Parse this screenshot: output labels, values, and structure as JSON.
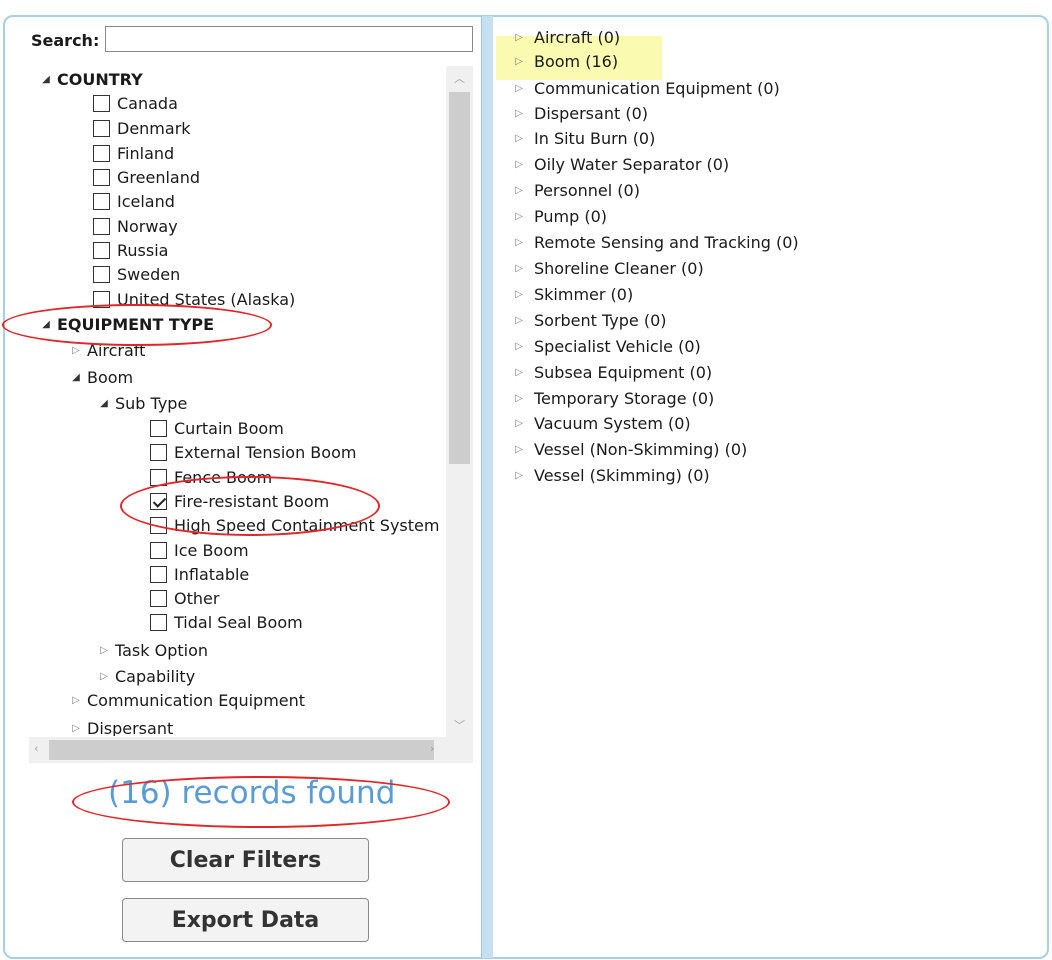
{
  "search": {
    "label": "Search:",
    "value": "",
    "placeholder": ""
  },
  "tree": {
    "country": {
      "label": "COUNTRY",
      "items": [
        "Canada",
        "Denmark",
        "Finland",
        "Greenland",
        "Iceland",
        "Norway",
        "Russia",
        "Sweden",
        "United States (Alaska)"
      ]
    },
    "equipment_type": {
      "label": "EQUIPMENT TYPE",
      "aircraft": "Aircraft",
      "boom": {
        "label": "Boom",
        "sub_type": {
          "label": "Sub Type",
          "items": [
            {
              "label": "Curtain Boom",
              "checked": false
            },
            {
              "label": "External Tension Boom",
              "checked": false
            },
            {
              "label": "Fence Boom",
              "checked": false
            },
            {
              "label": "Fire-resistant Boom",
              "checked": true
            },
            {
              "label": "High Speed Containment System",
              "checked": false
            },
            {
              "label": "Ice Boom",
              "checked": false
            },
            {
              "label": "Inflatable",
              "checked": false
            },
            {
              "label": "Other",
              "checked": false
            },
            {
              "label": "Tidal Seal Boom",
              "checked": false
            }
          ]
        },
        "task_option": "Task Option",
        "capability": "Capability"
      },
      "communication_equipment": "Communication Equipment",
      "dispersant": "Dispersant"
    }
  },
  "status": {
    "records_found": "(16) records found"
  },
  "buttons": {
    "clear_filters": "Clear Filters",
    "export_data": "Export Data"
  },
  "results": [
    "Aircraft (0)",
    "Boom (16)",
    "Communication Equipment (0)",
    "Dispersant (0)",
    "In Situ Burn (0)",
    "Oily Water Separator (0)",
    "Personnel (0)",
    "Pump (0)",
    "Remote Sensing and Tracking (0)",
    "Shoreline Cleaner (0)",
    "Skimmer (0)",
    "Sorbent Type (0)",
    "Specialist Vehicle (0)",
    "Subsea Equipment (0)",
    "Temporary Storage (0)",
    "Vacuum System (0)",
    "Vessel (Non-Skimming) (0)",
    "Vessel (Skimming) (0)"
  ],
  "colors": {
    "accent": "#5b9bd5",
    "highlight": "#fafab0",
    "annotation": "#e0262a",
    "divider": "#c6dff1"
  }
}
